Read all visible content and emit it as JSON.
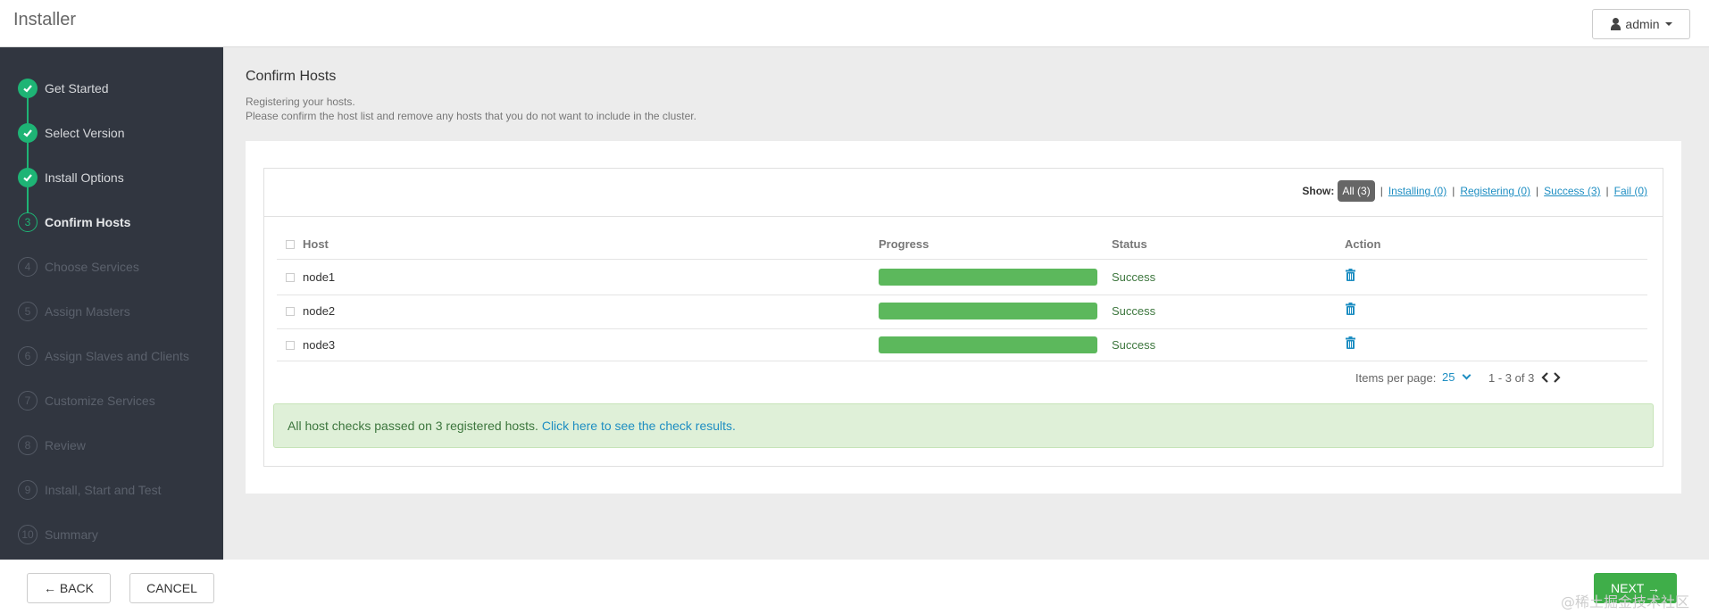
{
  "header": {
    "app_title": "Installer",
    "user_label": "admin"
  },
  "sidebar": {
    "steps": [
      {
        "num": "",
        "label": "Get Started",
        "state": "done"
      },
      {
        "num": "",
        "label": "Select Version",
        "state": "done"
      },
      {
        "num": "",
        "label": "Install Options",
        "state": "done"
      },
      {
        "num": "3",
        "label": "Confirm Hosts",
        "state": "current"
      },
      {
        "num": "4",
        "label": "Choose Services",
        "state": "todo"
      },
      {
        "num": "5",
        "label": "Assign Masters",
        "state": "todo"
      },
      {
        "num": "6",
        "label": "Assign Slaves and Clients",
        "state": "todo"
      },
      {
        "num": "7",
        "label": "Customize Services",
        "state": "todo"
      },
      {
        "num": "8",
        "label": "Review",
        "state": "todo"
      },
      {
        "num": "9",
        "label": "Install, Start and Test",
        "state": "todo"
      },
      {
        "num": "10",
        "label": "Summary",
        "state": "todo"
      }
    ]
  },
  "main": {
    "title": "Confirm Hosts",
    "subtitle_1": "Registering your hosts.",
    "subtitle_2": "Please confirm the host list and remove any hosts that you do not want to include in the cluster."
  },
  "filters": {
    "show_label": "Show:",
    "all": "All (3)",
    "installing": "Installing (0)",
    "registering": "Registering (0)",
    "success": "Success (3)",
    "fail": "Fail (0)"
  },
  "table": {
    "headers": {
      "host": "Host",
      "progress": "Progress",
      "status": "Status",
      "action": "Action"
    },
    "rows": [
      {
        "host": "node1",
        "progress": 1.0,
        "status": "Success",
        "action_icon": "trash-icon"
      },
      {
        "host": "node2",
        "progress": 1.0,
        "status": "Success",
        "action_icon": "trash-icon"
      },
      {
        "host": "node3",
        "progress": 1.0,
        "status": "Success",
        "action_icon": "trash-icon"
      }
    ]
  },
  "pagination": {
    "items_per_page_label": "Items per page:",
    "per_page_value": "25",
    "range": "1 - 3 of 3"
  },
  "alert": {
    "text": "All host checks passed on 3 registered hosts. ",
    "link": "Click here to see the check results."
  },
  "footer": {
    "back": "← BACK",
    "cancel": "CANCEL",
    "next": "NEXT →"
  },
  "watermark": "@稀土掘金技术社区",
  "colors": {
    "accent_green": "#1eb475",
    "success_bar": "#5cb85c",
    "link_blue": "#1e8ec2",
    "sidebar_bg": "#313640"
  }
}
